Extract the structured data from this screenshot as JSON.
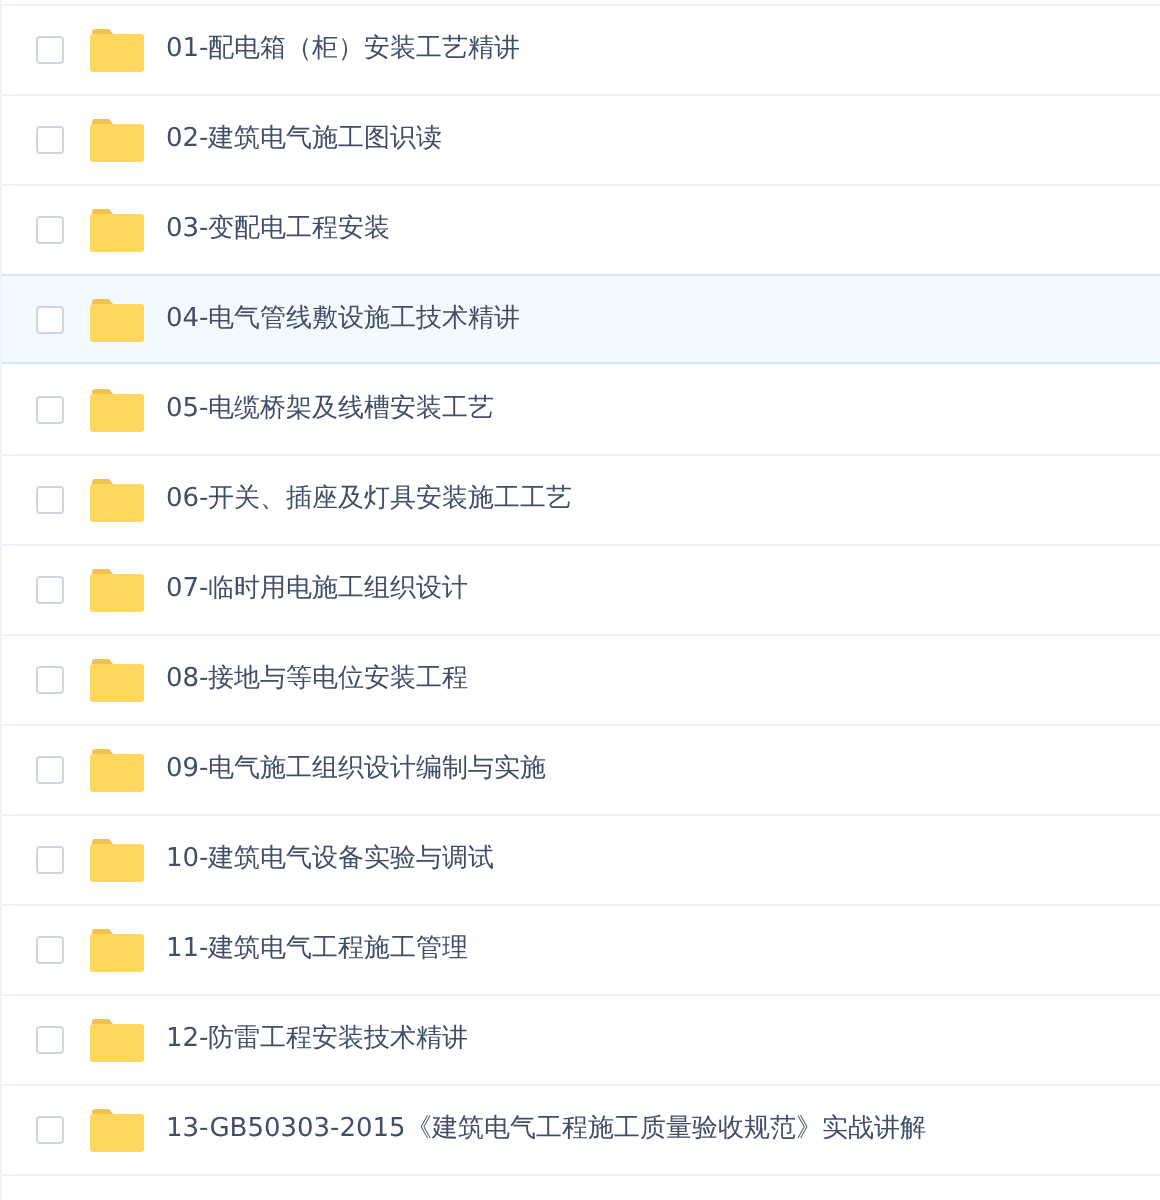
{
  "files": [
    {
      "name": "01-配电箱（柜）安装工艺精讲",
      "checked": false,
      "highlighted": false
    },
    {
      "name": "02-建筑电气施工图识读",
      "checked": false,
      "highlighted": false
    },
    {
      "name": "03-变配电工程安装",
      "checked": false,
      "highlighted": false
    },
    {
      "name": "04-电气管线敷设施工技术精讲",
      "checked": false,
      "highlighted": true
    },
    {
      "name": "05-电缆桥架及线槽安装工艺",
      "checked": false,
      "highlighted": false
    },
    {
      "name": "06-开关、插座及灯具安装施工工艺",
      "checked": false,
      "highlighted": false
    },
    {
      "name": "07-临时用电施工组织设计",
      "checked": false,
      "highlighted": false
    },
    {
      "name": "08-接地与等电位安装工程",
      "checked": false,
      "highlighted": false
    },
    {
      "name": "09-电气施工组织设计编制与实施",
      "checked": false,
      "highlighted": false
    },
    {
      "name": "10-建筑电气设备实验与调试",
      "checked": false,
      "highlighted": false
    },
    {
      "name": "11-建筑电气工程施工管理",
      "checked": false,
      "highlighted": false
    },
    {
      "name": "12-防雷工程安装技术精讲",
      "checked": false,
      "highlighted": false
    },
    {
      "name": "13-GB50303-2015《建筑电气工程施工质量验收规范》实战讲解",
      "checked": false,
      "highlighted": false
    }
  ]
}
